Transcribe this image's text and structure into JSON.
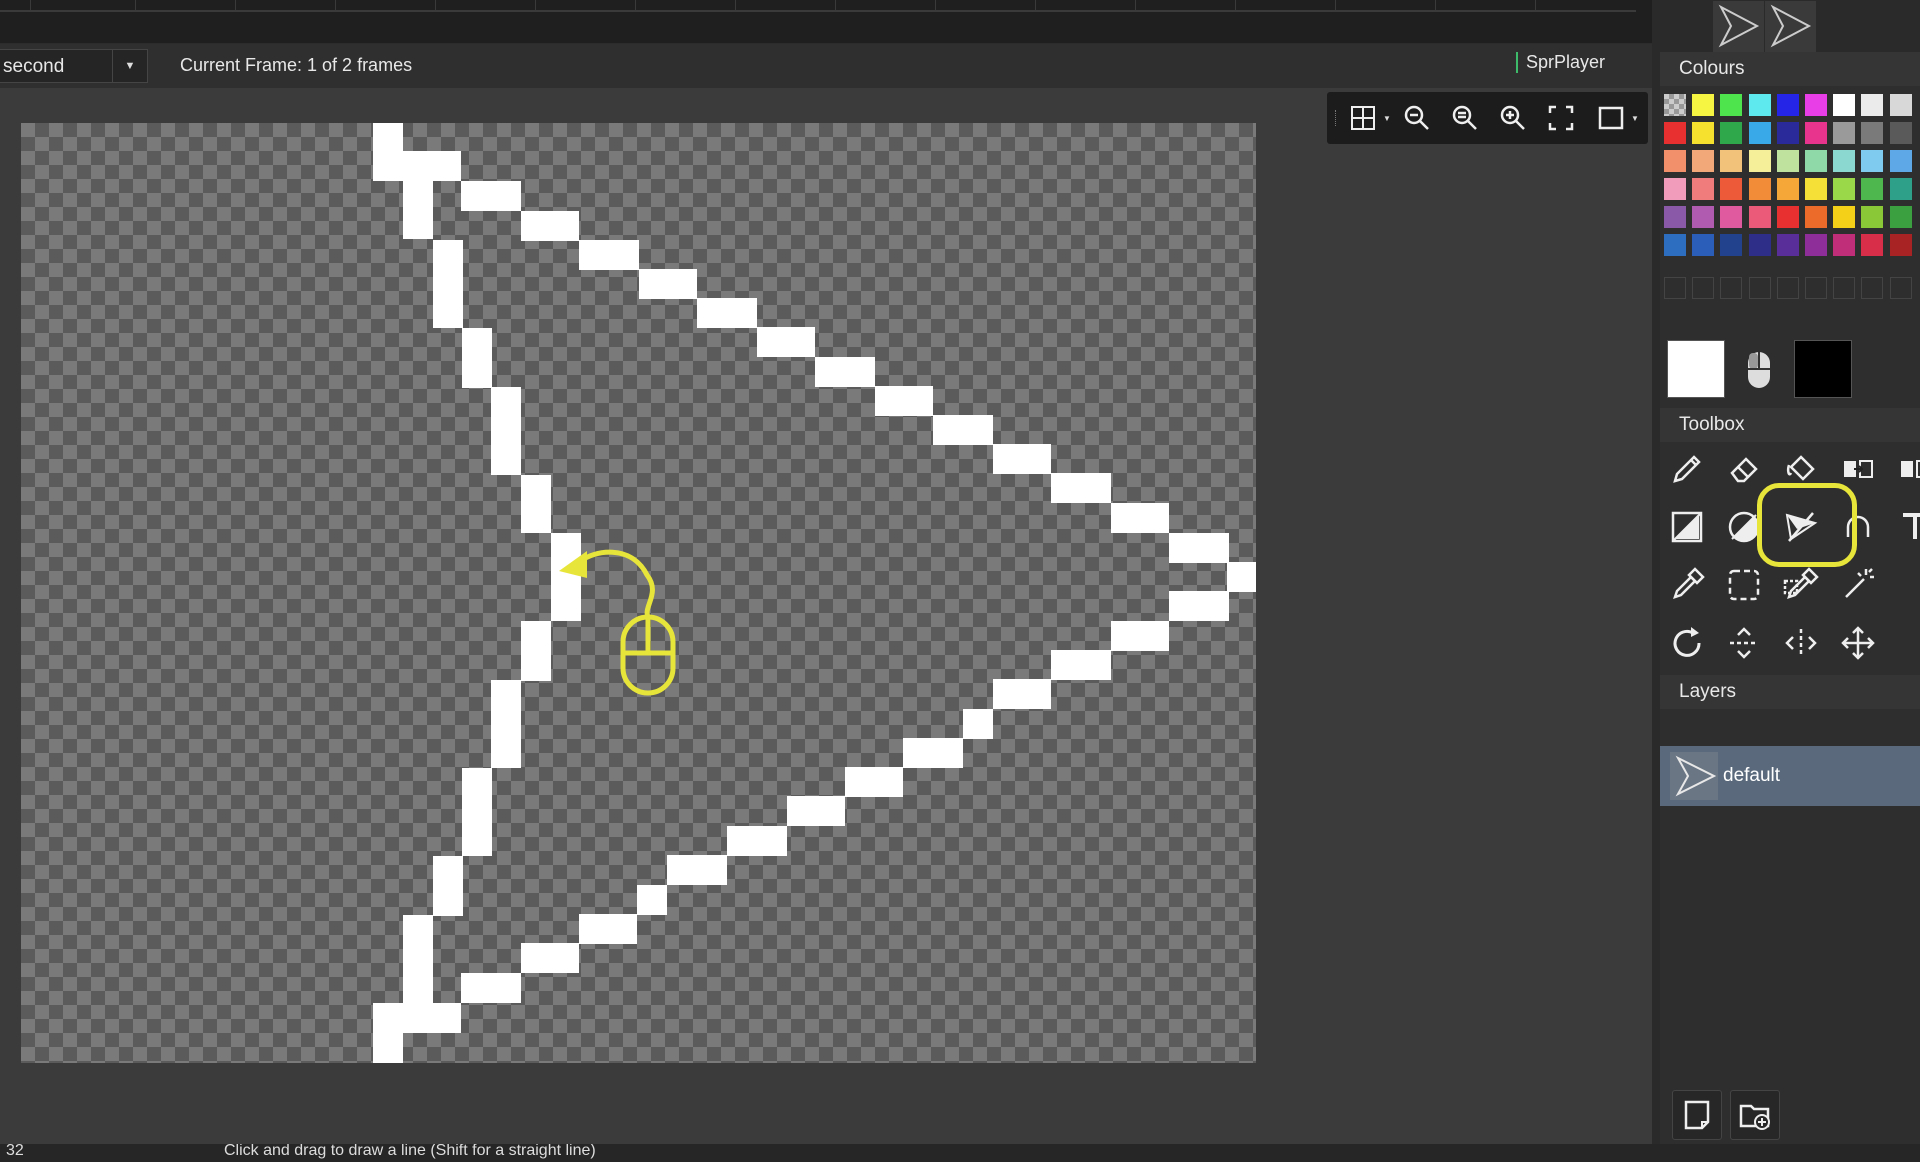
{
  "animation_select": {
    "value": "second"
  },
  "frame_label": "Current Frame: 1 of 2 frames",
  "player_label": "SprPlayer",
  "panels": {
    "colours_title": "Colours",
    "toolbox_title": "Toolbox",
    "layers_title": "Layers"
  },
  "palette": [
    [
      "transparent",
      "#f5f542",
      "#4ee44e",
      "#5ee9ee",
      "#2525e8",
      "#e83ee8",
      "#ffffff",
      "#ebebeb",
      "#d8d8d8"
    ],
    [
      "#e83030",
      "#f5e12e",
      "#2ea84a",
      "#39a9e8",
      "#2a2a9a",
      "#e8348c",
      "#9a9a9a",
      "#7a7a7a",
      "#5a5a5a"
    ],
    [
      "#f2906c",
      "#f2a878",
      "#f2c27a",
      "#f5ef9a",
      "#bfe29e",
      "#8fd8a8",
      "#8ad8d0",
      "#7ecbef",
      "#5ea8e8"
    ],
    [
      "#f29cbc",
      "#f07c7c",
      "#ec5a3a",
      "#f28c38",
      "#f5a838",
      "#f5e038",
      "#9ad84a",
      "#4eb84e",
      "#2ea08a"
    ],
    [
      "#8a5aa8",
      "#b05ab0",
      "#e05aa0",
      "#ec5a7a",
      "#e83030",
      "#ec6a2a",
      "#f5d018",
      "#8ac838",
      "#3aa040"
    ],
    [
      "#2e6ec0",
      "#2a5eb8",
      "#22428e",
      "#2e2e88",
      "#5a2e98",
      "#8e2e98",
      "#c02e7a",
      "#d82e4a",
      "#a82424"
    ]
  ],
  "layers": [
    {
      "name": "default"
    }
  ],
  "statusbar": {
    "coord": "32",
    "hint": "Click and drag to draw a line (Shift for a straight line)"
  },
  "tools": [
    "pencil-tool",
    "eraser-tool",
    "bucket-fill-tool",
    "flip-tool",
    "transform-tool",
    "rectangle-tool",
    "ellipse-tool",
    "line-tool",
    "curve-tool",
    "text-tool",
    "eyedropper-tool",
    "rect-select-tool",
    "color-replace-tool",
    "magic-wand-tool",
    "rotate-tool",
    "flip-vertical-tool",
    "flip-horizontal-tool",
    "move-tool"
  ],
  "active_tool": "line-tool",
  "colors": {
    "primary": "#ffffff",
    "secondary": "#000000",
    "highlight": "#e8e53a"
  }
}
